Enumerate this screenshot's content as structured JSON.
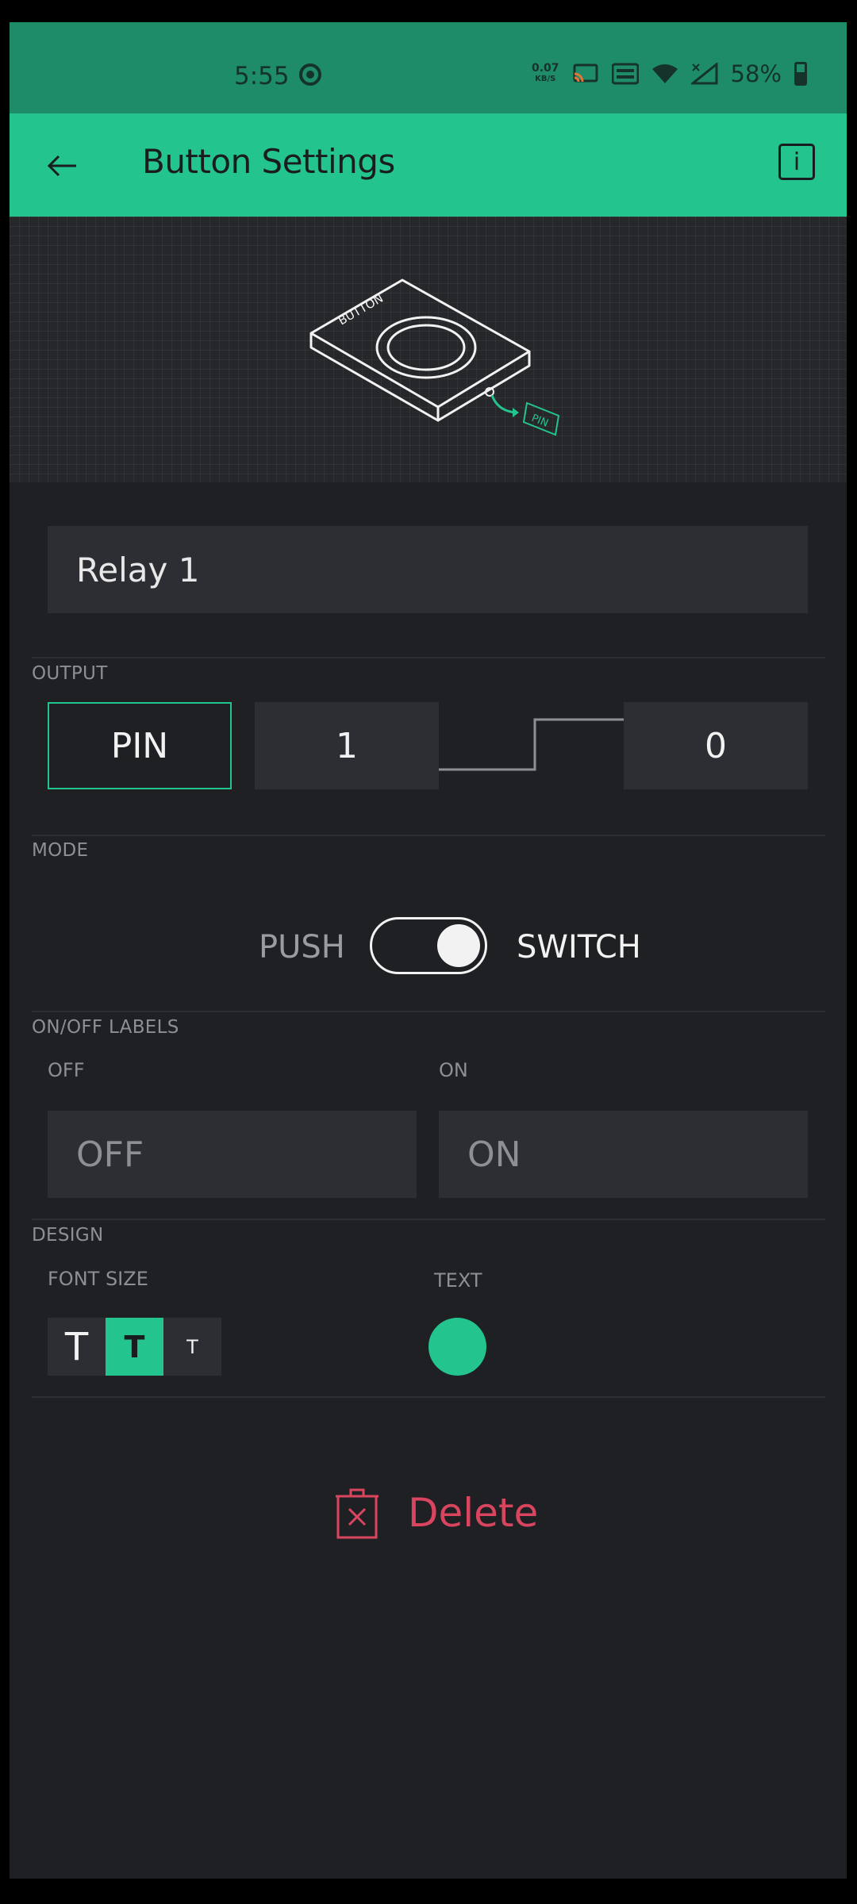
{
  "status_bar": {
    "time": "5:55",
    "speed_value": "0.07",
    "speed_unit": "KB/S",
    "battery": "58%"
  },
  "app_bar": {
    "title": "Button Settings",
    "info_label": "i"
  },
  "illustration": {
    "device_label": "BUTTON",
    "pin_label": "PIN"
  },
  "name_field": {
    "value": "Relay 1"
  },
  "output": {
    "section_label": "OUTPUT",
    "pin_button": "PIN",
    "high_value": "1",
    "low_value": "0"
  },
  "mode": {
    "section_label": "MODE",
    "push_label": "PUSH",
    "switch_label": "SWITCH",
    "selected": "SWITCH"
  },
  "on_off_labels": {
    "section_label": "ON/OFF LABELS",
    "off_label": "OFF",
    "on_label": "ON",
    "off_placeholder": "OFF",
    "on_placeholder": "ON"
  },
  "design": {
    "section_label": "DESIGN",
    "font_size_label": "FONT SIZE",
    "font_options": [
      "T",
      "T",
      "T"
    ],
    "text_color_label": "TEXT",
    "text_color": "#23c48e"
  },
  "delete": {
    "label": "Delete"
  },
  "colors": {
    "accent": "#23c48e",
    "status_bar": "#1f8c69",
    "background": "#1f2023",
    "field": "#2d2e33",
    "danger": "#d9455f"
  }
}
